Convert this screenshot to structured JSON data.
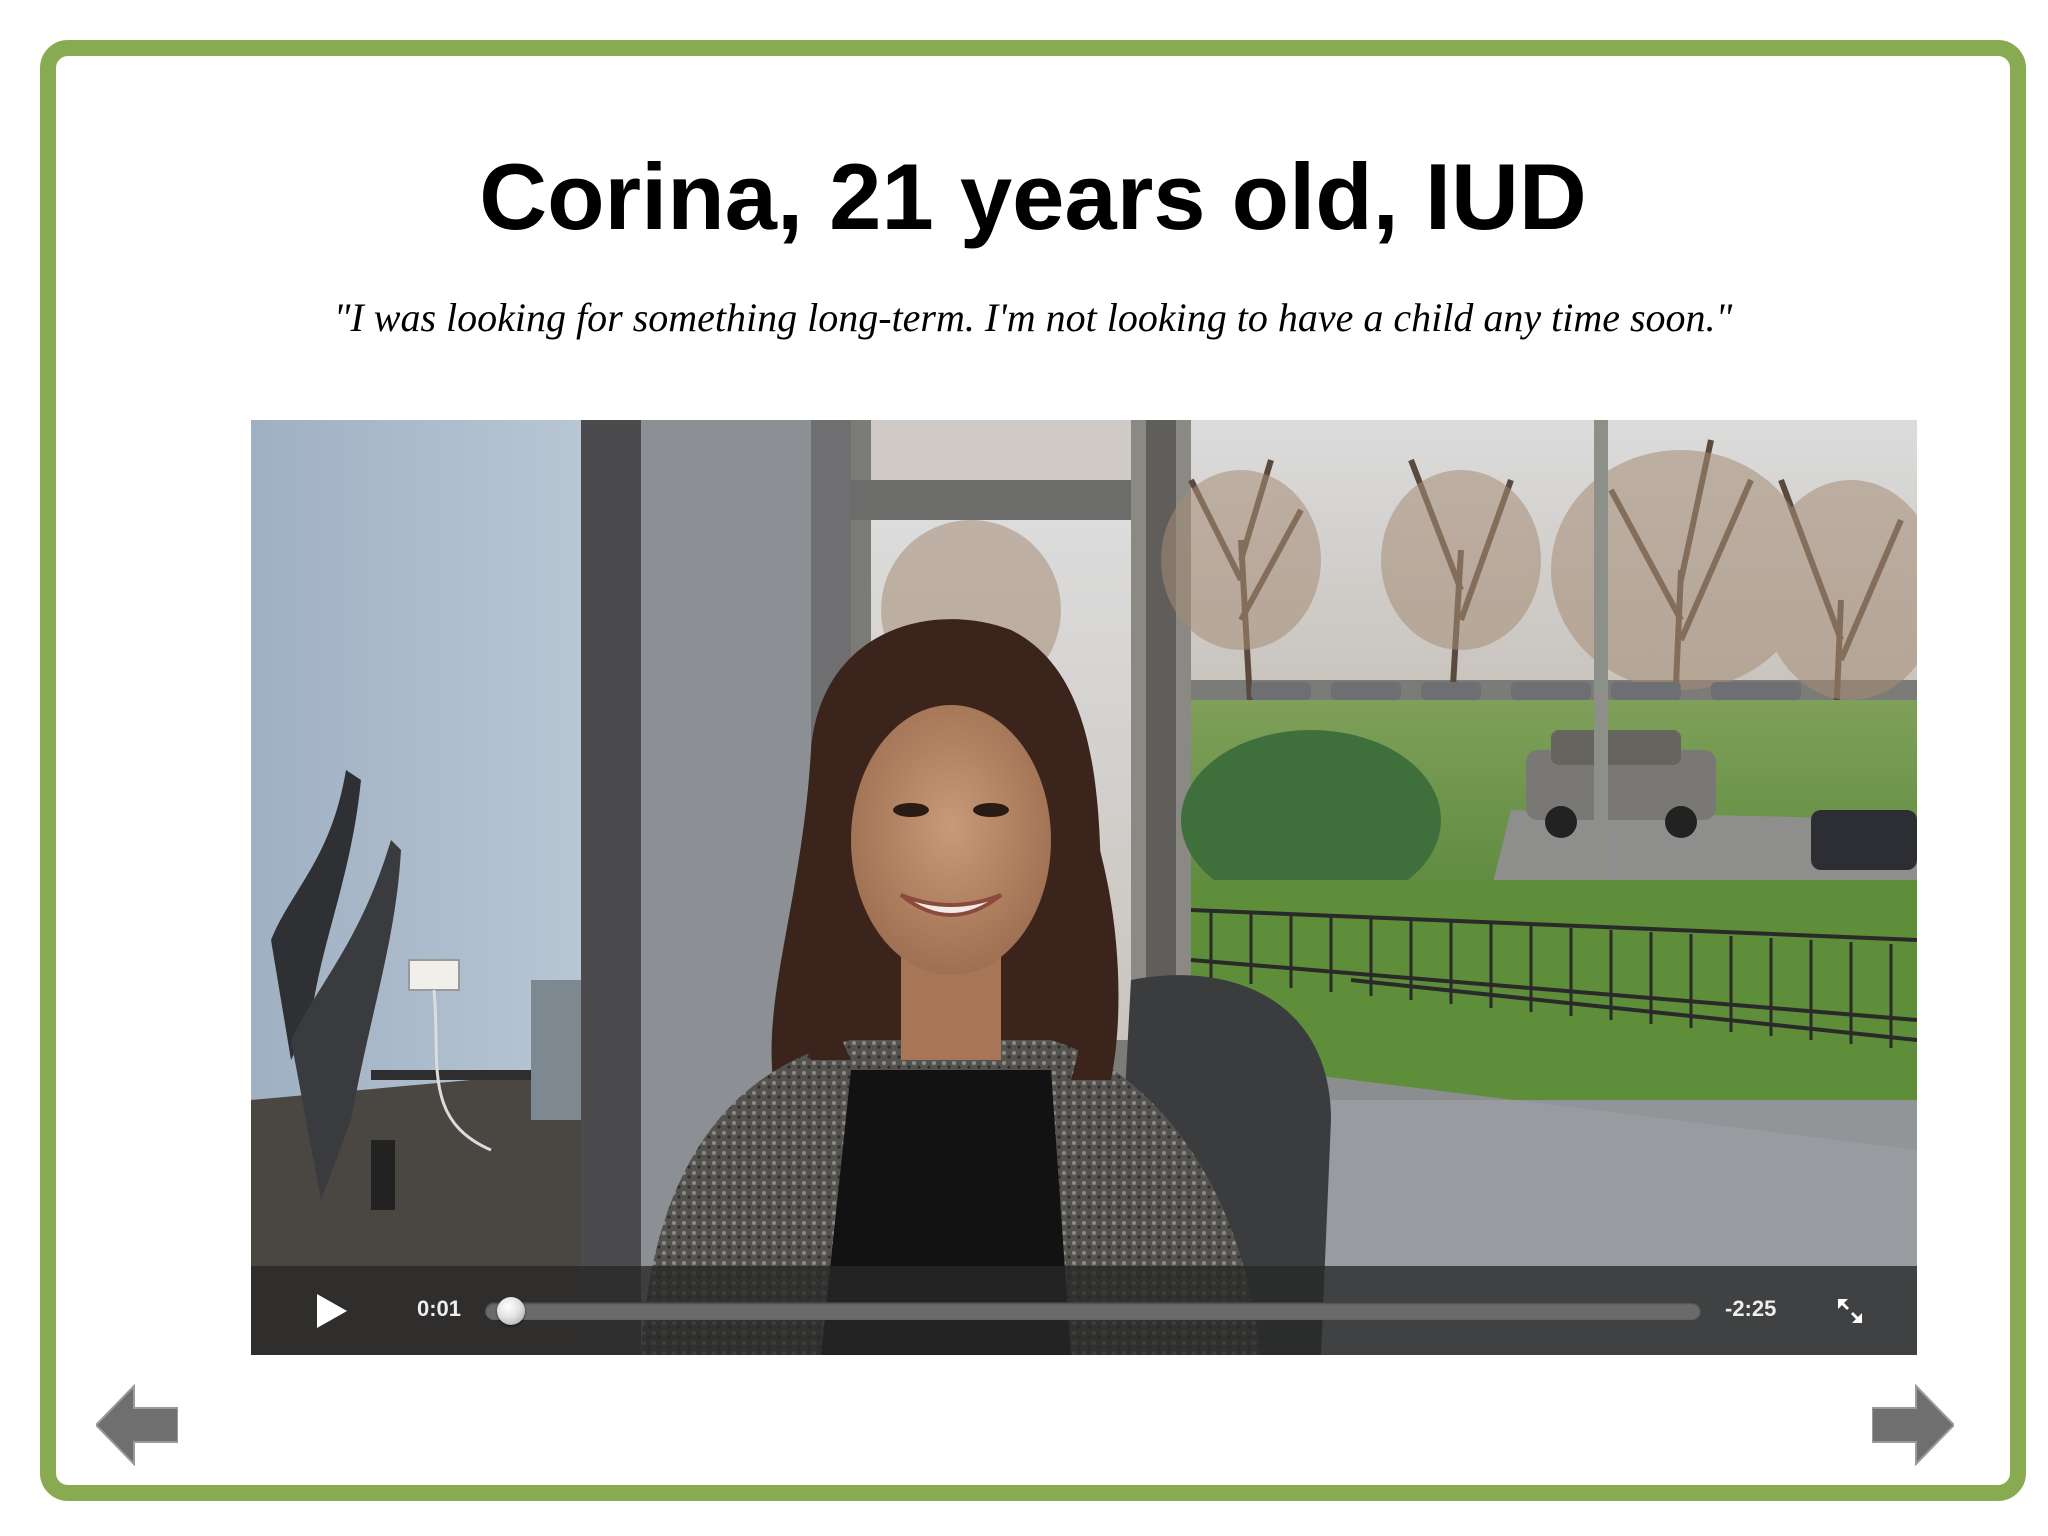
{
  "page": {
    "title": "Corina, 21 years old, IUD",
    "quote": "\"I was looking for something long-term. I'm not looking to have a child any time soon.\""
  },
  "video": {
    "current_time": "0:01",
    "remaining_time": "-2:25",
    "progress_fraction": 0.01,
    "play_icon": "play-icon",
    "fullscreen_icon": "fullscreen-icon"
  },
  "navigation": {
    "prev_icon": "arrow-left-icon",
    "next_icon": "arrow-right-icon"
  },
  "colors": {
    "frame_border": "#88ab52",
    "arrow": "#6f6f6f",
    "controls_bg": "#282828"
  }
}
